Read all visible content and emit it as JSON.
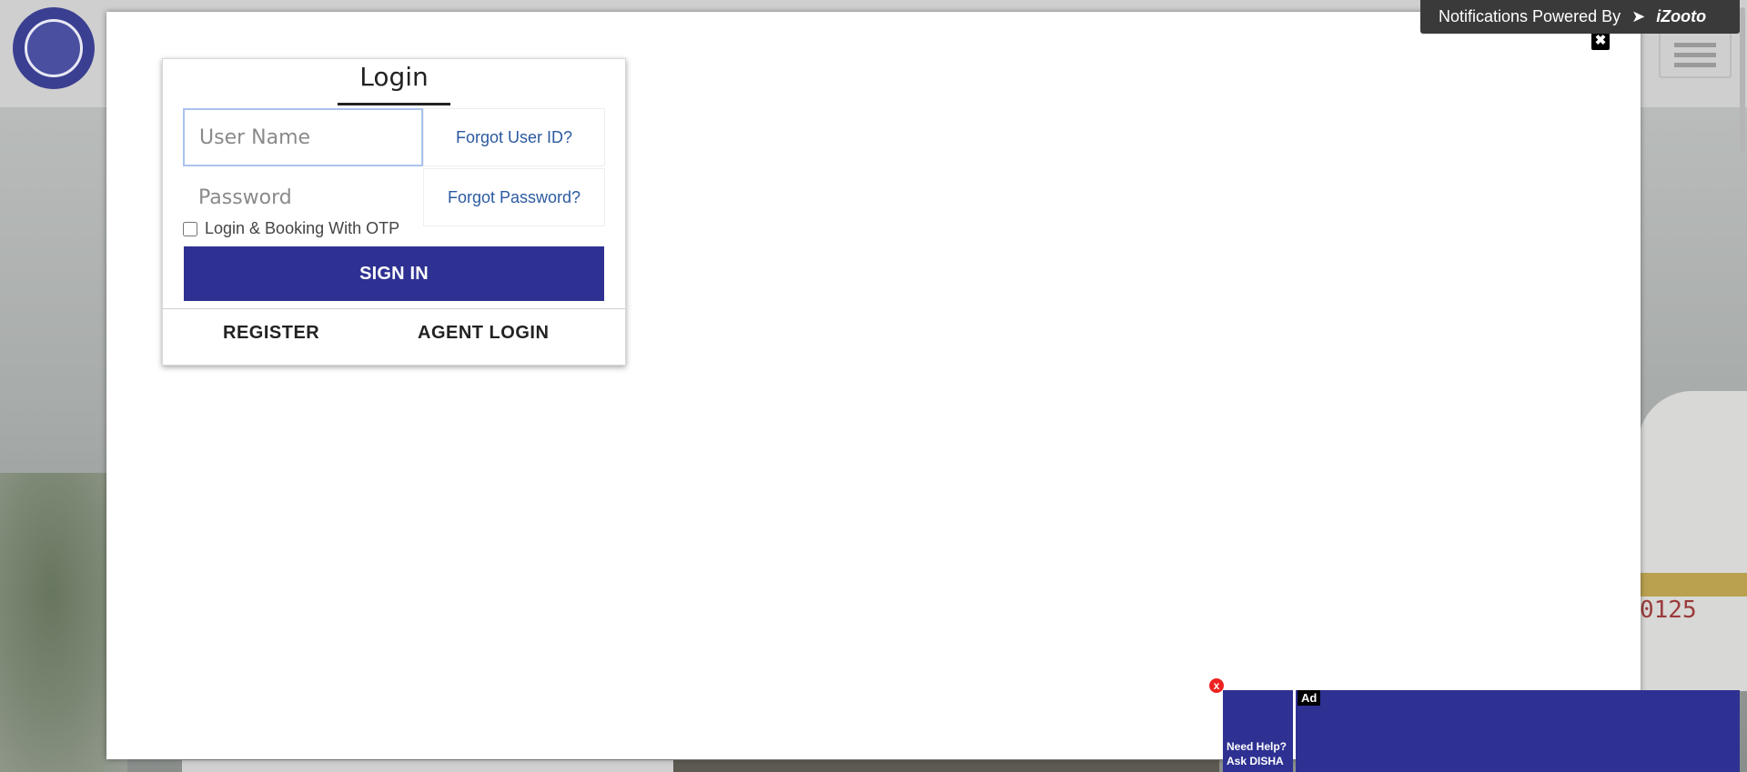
{
  "header": {
    "logo_alt": "Indian Railways",
    "menu_icon": "hamburger-menu-icon"
  },
  "background": {
    "train_number": "0125"
  },
  "notification": {
    "text": "Notifications Powered By",
    "brand": "iZooto"
  },
  "modal": {
    "close_icon": "✖"
  },
  "login": {
    "title": "Login",
    "username_placeholder": "User Name",
    "username_value": "",
    "password_placeholder": "Password",
    "password_value": "",
    "forgot_user": "Forgot User ID?",
    "forgot_password": "Forgot Password?",
    "otp_label": "Login & Booking With OTP",
    "otp_checked": false,
    "sign_in": "SIGN IN",
    "register": "REGISTER",
    "agent_login": "AGENT LOGIN"
  },
  "ad": {
    "close": "x",
    "help_line1": "Need Help?",
    "help_line2": "Ask DISHA",
    "badge": "Ad"
  },
  "colors": {
    "primary": "#2e3192",
    "link": "#2c5aa0"
  }
}
